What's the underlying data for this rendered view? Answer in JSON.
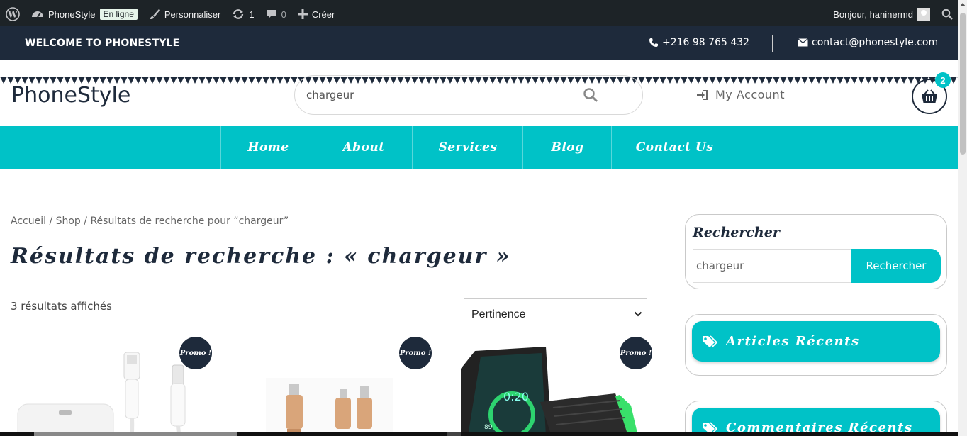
{
  "adminbar": {
    "wp_icon": "wordpress-icon",
    "site_name": "PhoneStyle",
    "status_badge": "En ligne",
    "customize": "Personnaliser",
    "updates_count": "1",
    "comments_count": "0",
    "create": "Créer",
    "greeting": "Bonjour, haninermd"
  },
  "topbar": {
    "welcome": "WELCOME TO PHONESTYLE",
    "phone": "+216 98 765 432",
    "email": "contact@phonestyle.com"
  },
  "header": {
    "logo": "PhoneStyle",
    "search_value": "chargeur",
    "account_label": "My Account",
    "cart_count": "2"
  },
  "nav": {
    "items": [
      {
        "label": "Home"
      },
      {
        "label": "About"
      },
      {
        "label": "Services"
      },
      {
        "label": "Blog"
      },
      {
        "label": "Contact Us"
      }
    ]
  },
  "content": {
    "breadcrumb": "Accueil / Shop / Résultats de recherche pour “chargeur”",
    "title": "Résultats de recherche : « chargeur »",
    "result_count": "3 résultats affichés",
    "orderby_selected": "Pertinence",
    "promo_label": "Promo !"
  },
  "sidebar": {
    "search_title": "Rechercher",
    "search_value": "chargeur",
    "search_button": "Rechercher",
    "recent_articles": "Articles Récents",
    "recent_comments": "Commentaires Récents"
  },
  "colors": {
    "accent": "#00c2c7",
    "dark": "#1e2a3b",
    "adminbar": "#1d2327"
  }
}
